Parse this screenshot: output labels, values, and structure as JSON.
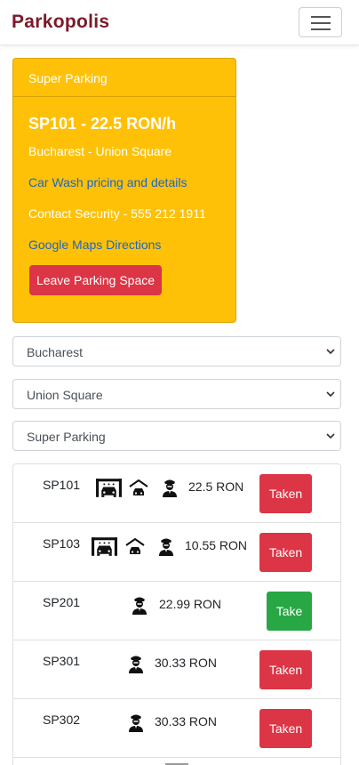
{
  "brand": {
    "name": "Parkopolis"
  },
  "colors": {
    "brand": "#7a1a2a",
    "card_bg": "#ffc107",
    "danger": "#dc3545",
    "success": "#28a745"
  },
  "card": {
    "header": "Super Parking",
    "title": "SP101 - 22.5 RON/h",
    "location": "Bucharest - Union Square",
    "car_wash_link": "Car Wash pricing and details",
    "contact": "Contact Security - 555 212 1911",
    "maps_link": "Google Maps Directions",
    "leave_button": "Leave Parking Space"
  },
  "filters": {
    "city": "Bucharest",
    "area": "Union Square",
    "provider": "Super Parking"
  },
  "spots": [
    {
      "code": "SP101",
      "price": "22.5 RON",
      "status": "Taken",
      "icons": [
        "car-wash-icon",
        "garage-icon",
        "security-guard-icon"
      ]
    },
    {
      "code": "SP103",
      "price": "10.55 RON",
      "status": "Taken",
      "icons": [
        "car-wash-icon",
        "garage-icon",
        "security-guard-icon"
      ]
    },
    {
      "code": "SP201",
      "price": "22.99 RON",
      "status": "Take",
      "icons": [
        "security-guard-icon"
      ]
    },
    {
      "code": "SP301",
      "price": "30.33 RON",
      "status": "Taken",
      "icons": [
        "security-guard-icon"
      ]
    },
    {
      "code": "SP302",
      "price": "30.33 RON",
      "status": "Taken",
      "icons": [
        "security-guard-icon"
      ]
    }
  ]
}
